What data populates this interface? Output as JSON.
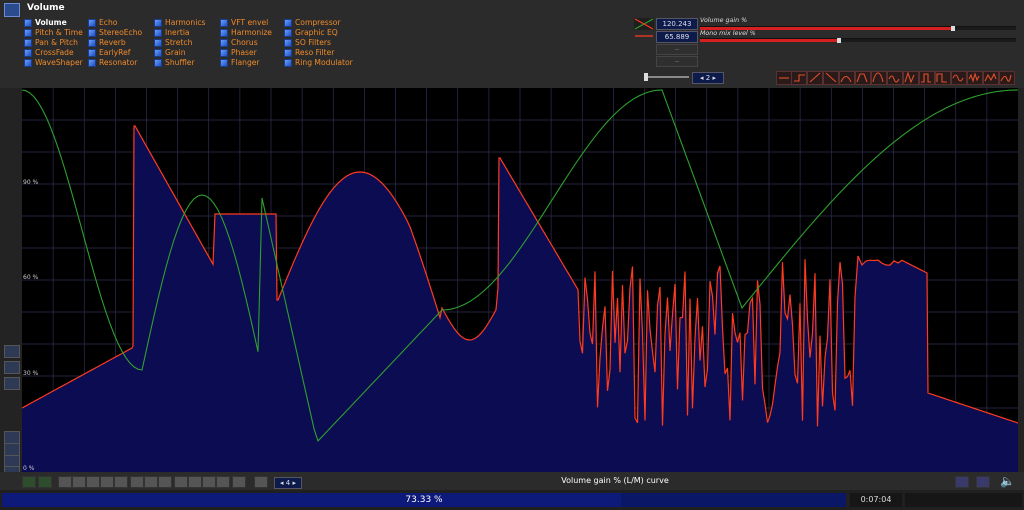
{
  "window": {
    "title": "Volume"
  },
  "effects": {
    "columns": [
      [
        "Volume",
        "Pitch & Time",
        "Pan & Pitch",
        "CrossFade",
        "WaveShaper"
      ],
      [
        "Echo",
        "StereoEcho",
        "Reverb",
        "EarlyRef",
        "Resonator"
      ],
      [
        "Harmonics",
        "Inertia",
        "Stretch",
        "Grain",
        "Shuffler"
      ],
      [
        "VFT envel",
        "Harmonize",
        "Chorus",
        "Phaser",
        "Flanger"
      ],
      [
        "Compressor",
        "Graphic EQ",
        "SO Filters",
        "Reso Filter",
        "Ring Modulator"
      ]
    ],
    "active": "Volume"
  },
  "params": [
    {
      "value": "120.243",
      "label": "Volume gain %",
      "level": 0.8
    },
    {
      "value": "65.889",
      "label": "Mono mix level %",
      "level": 0.44
    },
    {
      "value": "--"
    },
    {
      "value": "--"
    }
  ],
  "curve_stepper": {
    "value": "2"
  },
  "plot": {
    "y_ticks": [
      "90 %",
      "60 %",
      "30 %",
      "0 %"
    ],
    "grid": true,
    "colors": {
      "left_curve": "#ff3b1f",
      "right_curve": "#2ea02e",
      "fill": "#0c0c52"
    }
  },
  "toolbar": {
    "stepper_value": "4",
    "curve_label": "Volume gain % (L/M) curve"
  },
  "status": {
    "progress_text": "73.33 %",
    "progress": 73.33,
    "time": "0:07:04"
  },
  "colors": {
    "accent": "#d42020",
    "progress_bg": "#0a1666"
  },
  "icons": {
    "effect_checkbox": "checkbox-icon",
    "speaker": "speaker-icon"
  }
}
